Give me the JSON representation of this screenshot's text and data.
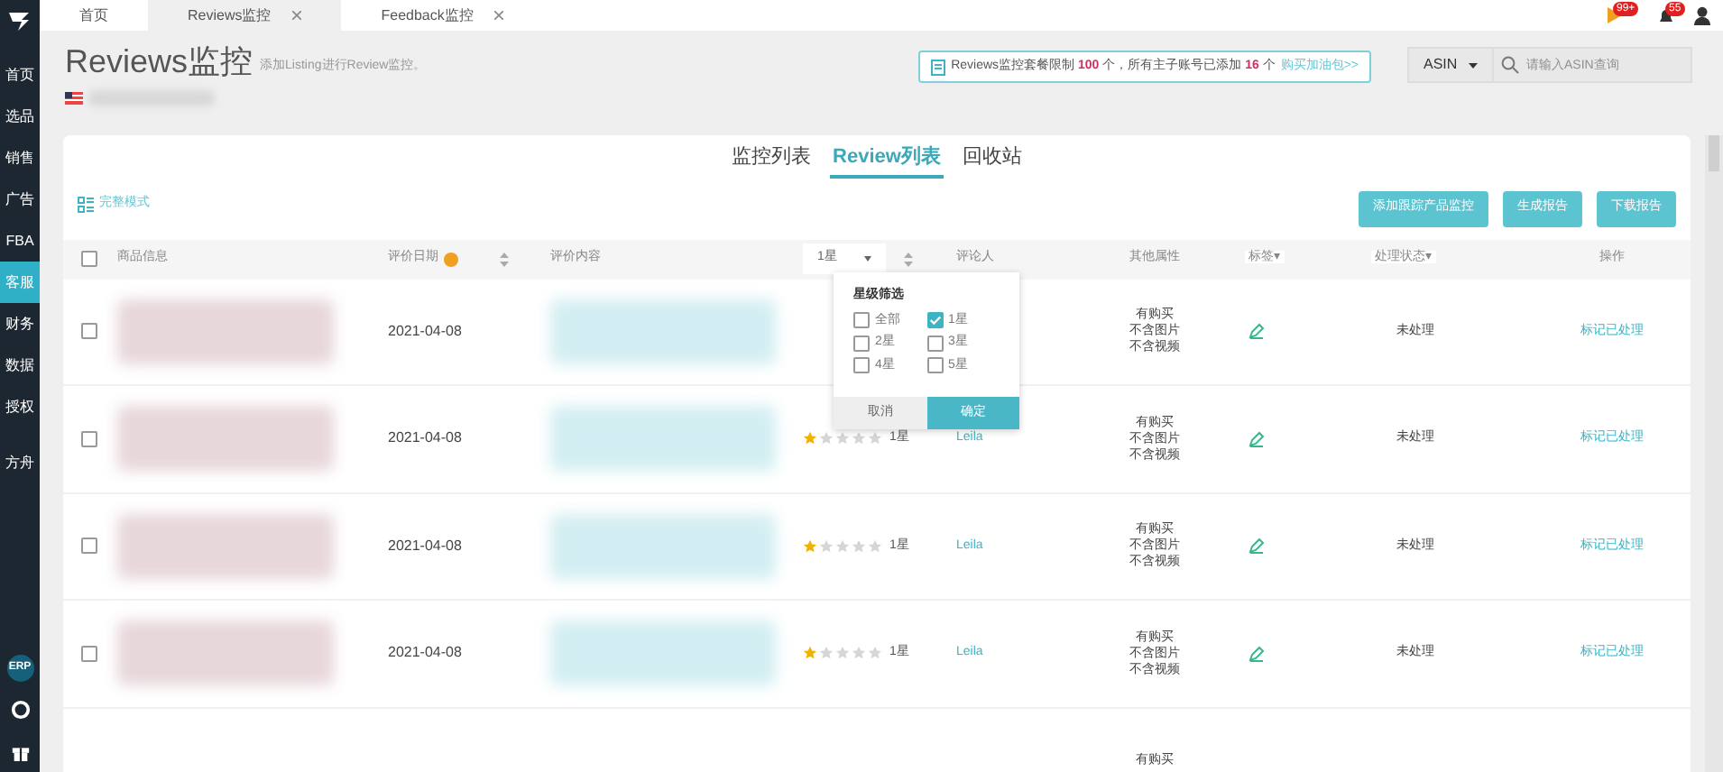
{
  "top_tabs": [
    {
      "label": "首页",
      "selected": false,
      "closable": false
    },
    {
      "label": "Reviews监控",
      "selected": true,
      "closable": true
    },
    {
      "label": "Feedback监控",
      "selected": false,
      "closable": true
    }
  ],
  "badges": [
    "99+",
    "55"
  ],
  "sidebar": {
    "items": [
      {
        "label": "首页",
        "selected": false
      },
      {
        "label": "选品",
        "selected": false
      },
      {
        "label": "销售",
        "selected": false
      },
      {
        "label": "广告",
        "selected": false
      },
      {
        "label": "FBA",
        "selected": false
      },
      {
        "label": "客服",
        "selected": true
      },
      {
        "label": "财务",
        "selected": false
      },
      {
        "label": "数据",
        "selected": false
      },
      {
        "label": "授权",
        "selected": false
      },
      {
        "label": "方舟",
        "selected": false
      }
    ],
    "erp": "ERP"
  },
  "header": {
    "title": "Reviews监控",
    "subtitle": "添加Listing进行Review监控。"
  },
  "notice": {
    "before": "Reviews监控套餐限制",
    "limit": "100",
    "middle": "个，所有主子账号已添加",
    "count": "16",
    "after": "个",
    "link": "购买加油包>>"
  },
  "search": {
    "type": "ASIN",
    "placeholder": "请输入ASIN查询"
  },
  "view_tabs": [
    {
      "label": "监控列表",
      "selected": false
    },
    {
      "label": "Review列表",
      "selected": true
    },
    {
      "label": "回收站",
      "selected": false
    }
  ],
  "mode_link": "完整模式",
  "buttons": [
    "添加跟踪产品监控",
    "生成报告",
    "下载报告"
  ],
  "table": {
    "select_all_checked": false,
    "columns": {
      "product": "商品信息",
      "date": "评价日期",
      "content": "评价内容",
      "rating": "1星",
      "reviewer": "评论人",
      "attributes": "其他属性",
      "tag": "标签▾",
      "status": "处理状态▾",
      "action": "操作"
    },
    "rows": [
      {
        "checked": false,
        "date": "2021-04-08",
        "attributes": [
          "有购买",
          "不含图片",
          "不含视频"
        ],
        "status": "未处理",
        "action": "标记已处理"
      },
      {
        "checked": false,
        "date": "2021-04-08",
        "stars": 1,
        "rating": "1星",
        "reviewer": "Leila",
        "attributes": [
          "有购买",
          "不含图片",
          "不含视频"
        ],
        "status": "未处理",
        "action": "标记已处理"
      },
      {
        "checked": false,
        "date": "2021-04-08",
        "stars": 1,
        "rating": "1星",
        "reviewer": "Leila",
        "attributes": [
          "有购买",
          "不含图片",
          "不含视频"
        ],
        "status": "未处理",
        "action": "标记已处理"
      },
      {
        "checked": false,
        "date": "2021-04-08",
        "stars": 1,
        "rating": "1星",
        "reviewer": "Leila",
        "attributes": [
          "有购买",
          "不含图片",
          "不含视频"
        ],
        "status": "未处理",
        "action": "标记已处理"
      },
      {
        "attributes": [
          "有购买"
        ]
      }
    ]
  },
  "rating_filter": {
    "title": "星级筛选",
    "options": [
      {
        "label": "全部",
        "checked": false
      },
      {
        "label": "1星",
        "checked": true
      },
      {
        "label": "2星",
        "checked": false
      },
      {
        "label": "3星",
        "checked": false
      },
      {
        "label": "4星",
        "checked": false
      },
      {
        "label": "5星",
        "checked": false
      }
    ],
    "buttons": [
      "取消",
      "确定"
    ]
  }
}
